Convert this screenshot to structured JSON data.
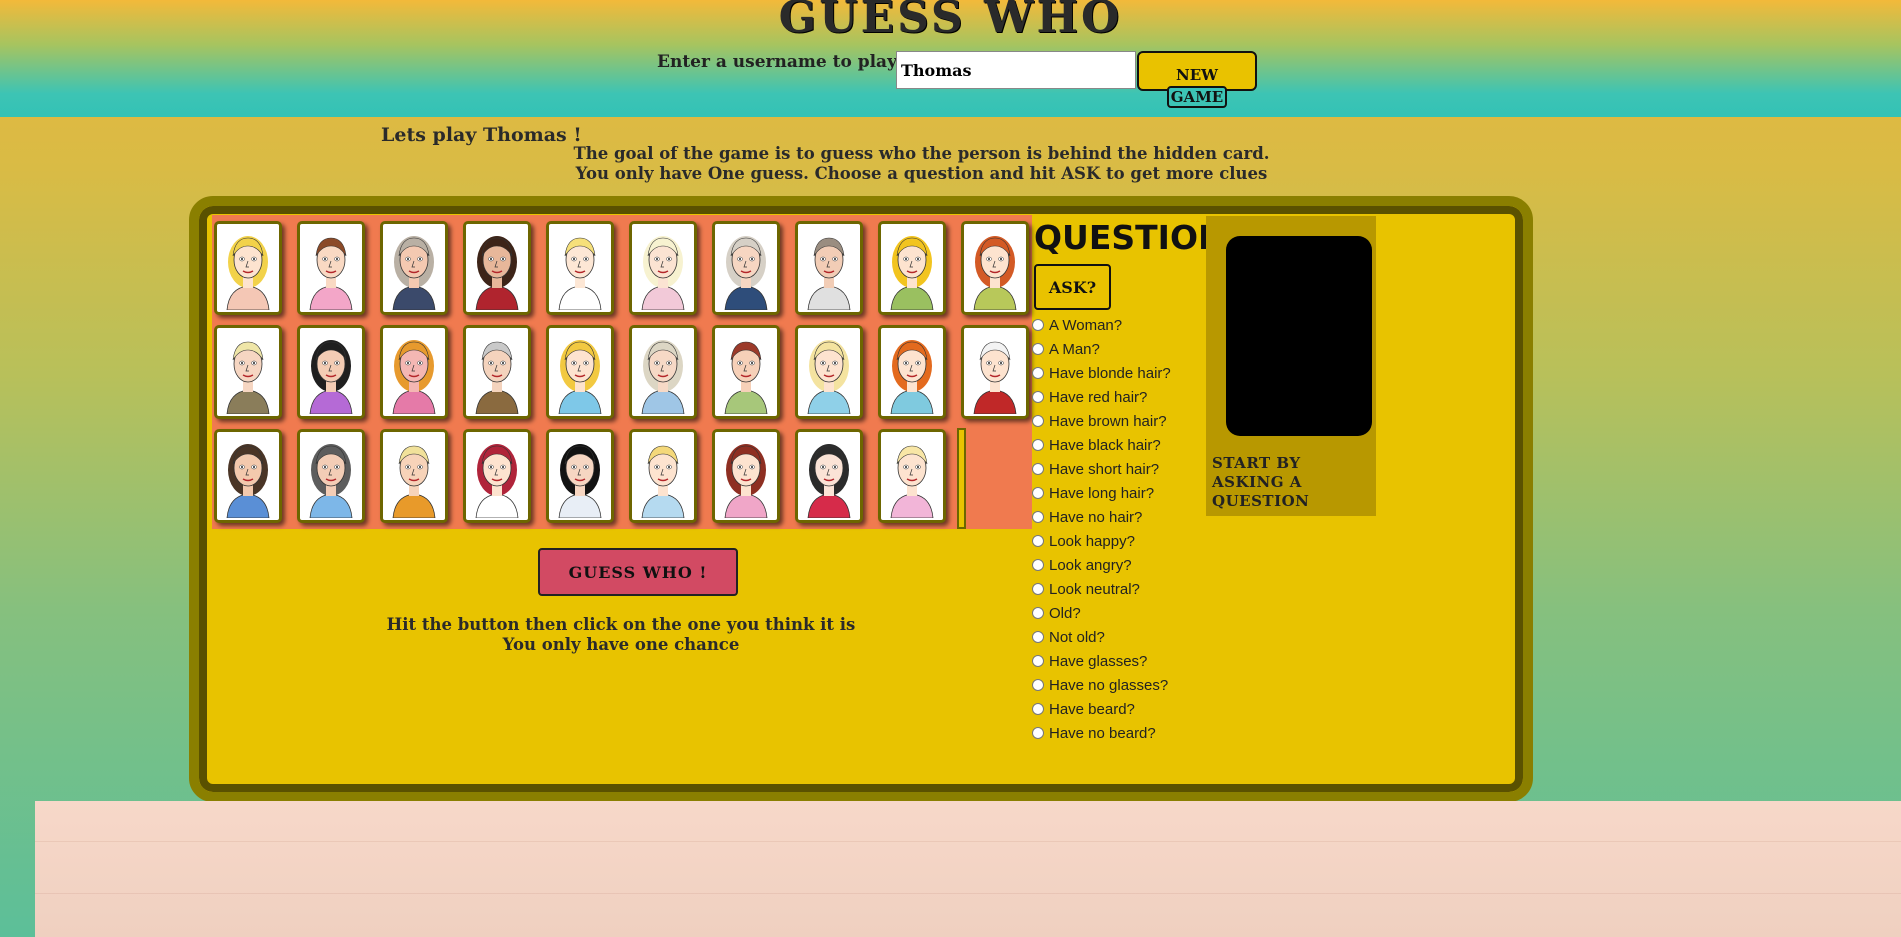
{
  "header": {
    "title": "GUESS WHO",
    "username_label": "Enter a username to play...",
    "username_value": "Thomas",
    "new_game_line1": "NEW",
    "new_game_line2": "GAME"
  },
  "intro": {
    "greeting": "Lets play Thomas !",
    "line1": "The goal of the game is to guess who the person is behind the hidden card.",
    "line2": "You only have One guess. Choose a question and hit ASK to get more clues"
  },
  "board": {
    "guess_button": "GUESS WHO !",
    "hint_line1": "Hit the button then click on the one you think it is",
    "hint_line2": "You only have one chance"
  },
  "questions": {
    "title": "QUESTIONS",
    "ask_button": "ASK?",
    "items": [
      "A Woman?",
      "A Man?",
      "Have blonde hair?",
      "Have red hair?",
      "Have brown hair?",
      "Have black hair?",
      "Have short hair?",
      "Have long hair?",
      "Have no hair?",
      "Look happy?",
      "Look angry?",
      "Look neutral?",
      "Old?",
      "Not old?",
      "Have glasses?",
      "Have no glasses?",
      "Have beard?",
      "Have no beard?"
    ]
  },
  "answer": {
    "text": "START BY ASKING A QUESTION"
  },
  "characters": [
    {
      "hair": "#f2d24a",
      "skin": "#fde3cf",
      "shirt": "#f4c7b5"
    },
    {
      "hair": "#8b4a28",
      "skin": "#f9d9c3",
      "shirt": "#f3a6c8"
    },
    {
      "hair": "#b9b0a4",
      "skin": "#f4c9b1",
      "shirt": "#3b4a6b"
    },
    {
      "hair": "#3d2418",
      "skin": "#e7b79a",
      "shirt": "#b0242e"
    },
    {
      "hair": "#f6e07a",
      "skin": "#fde7d5",
      "shirt": "#ffffff"
    },
    {
      "hair": "#f7f2d0",
      "skin": "#fbe3d2",
      "shirt": "#f2c9d8"
    },
    {
      "hair": "#d6d0c6",
      "skin": "#f6d6c2",
      "shirt": "#2e4d7a"
    },
    {
      "hair": "#9a8d80",
      "skin": "#f2cdb6",
      "shirt": "#e0e0e0"
    },
    {
      "hair": "#f2c41f",
      "skin": "#fde3cf",
      "shirt": "#9ac060"
    },
    {
      "hair": "#d35a25",
      "skin": "#fde3cf",
      "shirt": "#b8c85a"
    },
    {
      "hair": "#efe6a8",
      "skin": "#f6d6c2",
      "shirt": "#8a7d5a"
    },
    {
      "hair": "#1f1f1f",
      "skin": "#f3ccb4",
      "shirt": "#b56ad6"
    },
    {
      "hair": "#e79a2e",
      "skin": "#f4b7b3",
      "shirt": "#e57aa8"
    },
    {
      "hair": "#c9c9c9",
      "skin": "#f4d3bd",
      "shirt": "#8a6a3f"
    },
    {
      "hair": "#f2c941",
      "skin": "#fde3cf",
      "shirt": "#7ec8e8"
    },
    {
      "hair": "#dcd6c4",
      "skin": "#f6d9c6",
      "shirt": "#9fc6e6"
    },
    {
      "hair": "#9c3a2a",
      "skin": "#f6d0b8",
      "shirt": "#a7c77a"
    },
    {
      "hair": "#f4e3a0",
      "skin": "#fde3cf",
      "shirt": "#8fd0e8"
    },
    {
      "hair": "#e36a1e",
      "skin": "#fde3cf",
      "shirt": "#7fcadf"
    },
    {
      "hair": "#f3f3f3",
      "skin": "#fde3cf",
      "shirt": "#c02828"
    },
    {
      "hair": "#4a3526",
      "skin": "#f3c9ad",
      "shirt": "#5a8fd6"
    },
    {
      "hair": "#5d5d5d",
      "skin": "#f3cdb6",
      "shirt": "#7db7e8"
    },
    {
      "hair": "#f1e19a",
      "skin": "#f7d3b9",
      "shirt": "#e89a2a"
    },
    {
      "hair": "#b0243a",
      "skin": "#fde3cf",
      "shirt": "#ffffff"
    },
    {
      "hair": "#121212",
      "skin": "#f6d6c2",
      "shirt": "#e8eef6"
    },
    {
      "hair": "#f4d87a",
      "skin": "#fde3cf",
      "shirt": "#b5daf0"
    },
    {
      "hair": "#8e2f22",
      "skin": "#fde3cf",
      "shirt": "#f0a6c8"
    },
    {
      "hair": "#2b2b2b",
      "skin": "#fbe3d6",
      "shirt": "#d62b4a"
    },
    {
      "hair": "#f8e6a6",
      "skin": "#fde3cf",
      "shirt": "#f2b5d8"
    }
  ]
}
